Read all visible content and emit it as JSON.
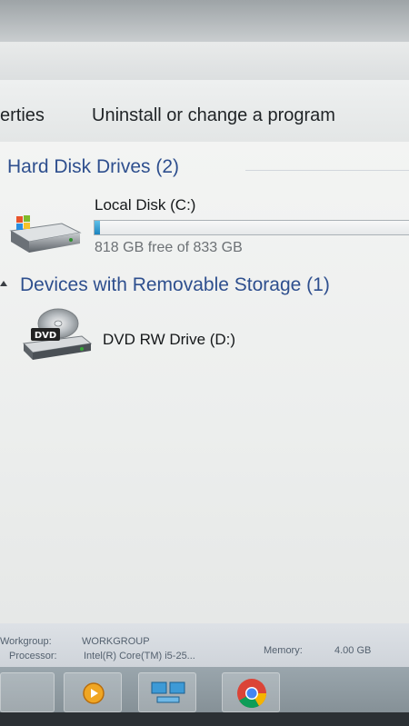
{
  "toolbar": {
    "properties_label": "erties",
    "uninstall_label": "Uninstall or change a program"
  },
  "groups": [
    {
      "title": "Hard Disk Drives (2)",
      "items": [
        {
          "name": "Local Disk (C:)",
          "space_text": "818 GB free of 833 GB",
          "used_fraction": 0.018,
          "icon": "hard-drive-windows-icon"
        }
      ]
    },
    {
      "title": "Devices with Removable Storage (1)",
      "items": [
        {
          "name": "DVD RW Drive (D:)",
          "icon": "dvd-drive-icon",
          "badge": "DVD"
        }
      ]
    }
  ],
  "details": {
    "workgroup_label": "Workgroup:",
    "workgroup_value": "WORKGROUP",
    "processor_label": "Processor:",
    "processor_value": "Intel(R) Core(TM) i5-25...",
    "memory_label": "Memory:",
    "memory_value": "4.00 GB"
  },
  "taskbar": {
    "apps": [
      "media-player-icon",
      "network-icon",
      "chrome-icon"
    ]
  },
  "colors": {
    "group_title": "#2e4f8e",
    "bar_fill": "#1c84bf"
  }
}
